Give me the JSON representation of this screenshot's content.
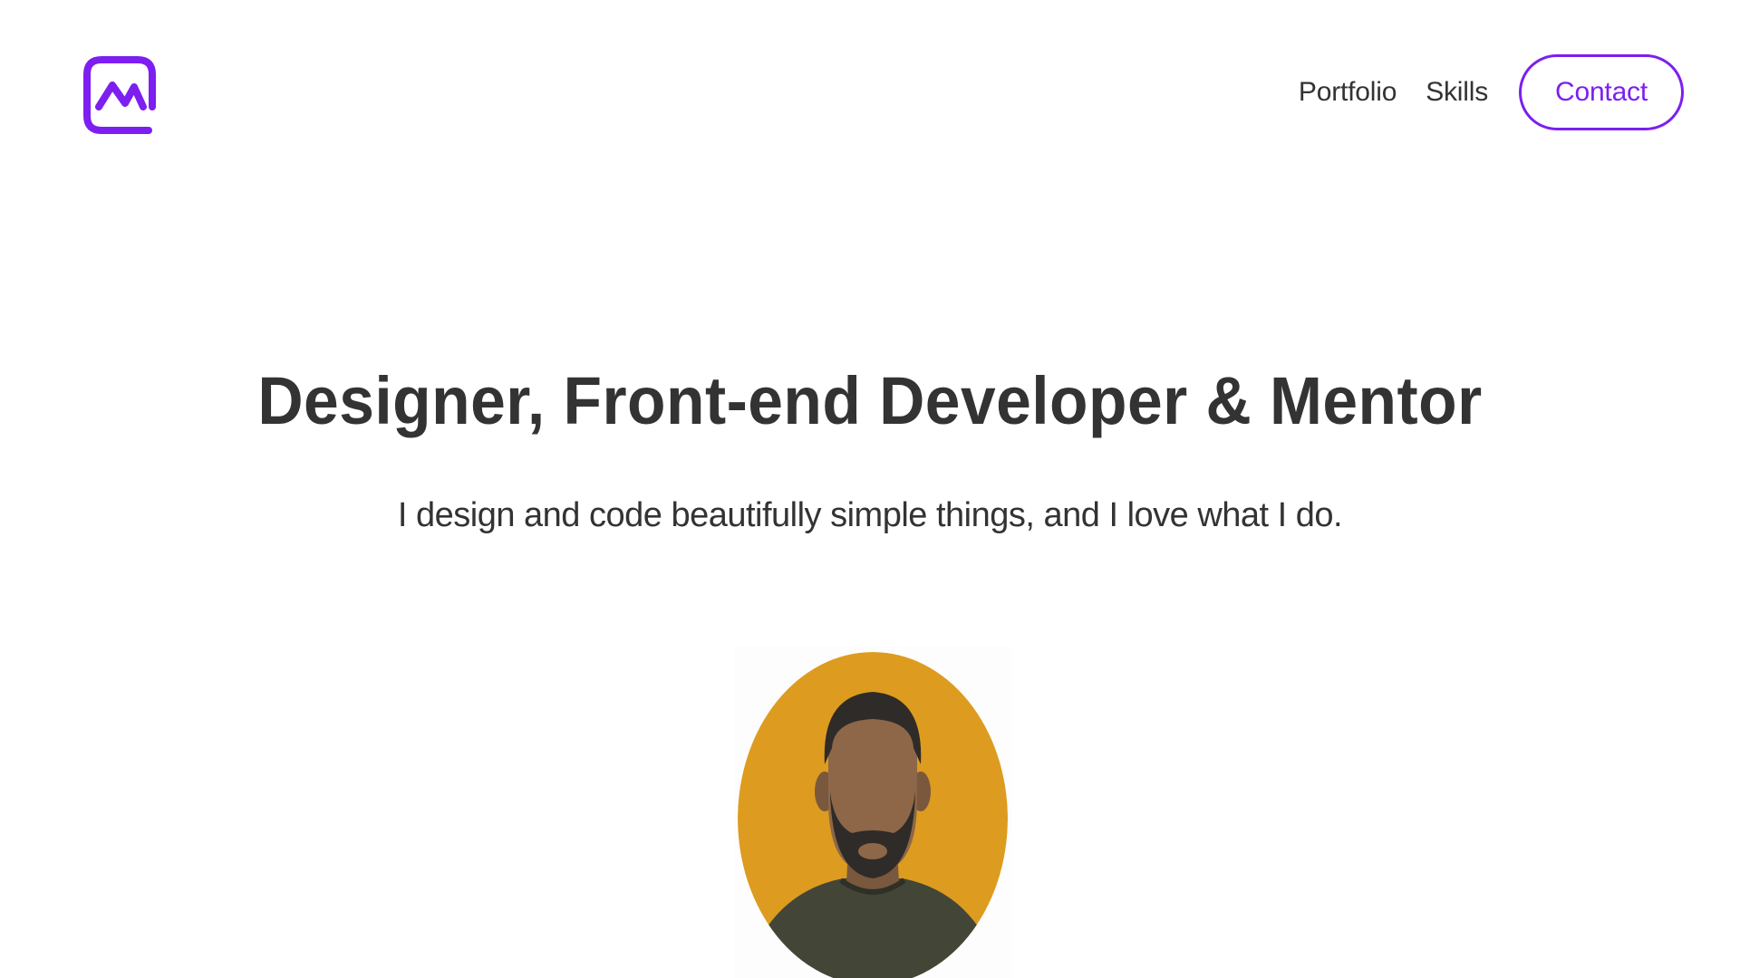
{
  "nav": {
    "logo": "logo-icon",
    "portfolio_label": "Portfolio",
    "skills_label": "Skills",
    "contact_label": "Contact"
  },
  "hero": {
    "title": "Designer, Front-end Developer & Mentor",
    "subtitle": "I design and code beautifully simple things, and I love what I do.",
    "avatar": "avatar-illustration"
  },
  "colors": {
    "accent": "#7c1ff0",
    "text": "#333333",
    "avatar_background": "#dd9c1f",
    "skin": "#8d6748",
    "hair_beard": "#2f2b28",
    "shirt": "#434637"
  }
}
